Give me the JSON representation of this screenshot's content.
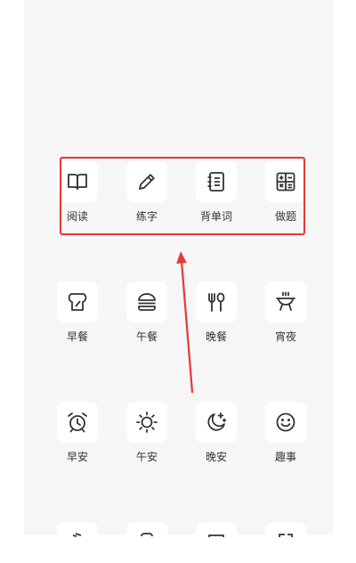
{
  "colors": {
    "background": "#f6f6f6",
    "tile": "#ffffff",
    "icon": "#333333",
    "highlight": "#e53935"
  },
  "grid": {
    "row1": [
      {
        "label": "阅读",
        "icon": "book-icon"
      },
      {
        "label": "练字",
        "icon": "pencil-icon"
      },
      {
        "label": "背单词",
        "icon": "notebook-icon"
      },
      {
        "label": "做题",
        "icon": "calculator-icon"
      }
    ],
    "row2": [
      {
        "label": "早餐",
        "icon": "toast-icon"
      },
      {
        "label": "午餐",
        "icon": "burger-icon"
      },
      {
        "label": "晚餐",
        "icon": "fork-spoon-icon"
      },
      {
        "label": "宵夜",
        "icon": "grill-icon"
      }
    ],
    "row3": [
      {
        "label": "早安",
        "icon": "alarm-clock-icon"
      },
      {
        "label": "午安",
        "icon": "sun-icon"
      },
      {
        "label": "晚安",
        "icon": "moon-stars-icon"
      },
      {
        "label": "趣事",
        "icon": "smiley-icon"
      }
    ]
  }
}
